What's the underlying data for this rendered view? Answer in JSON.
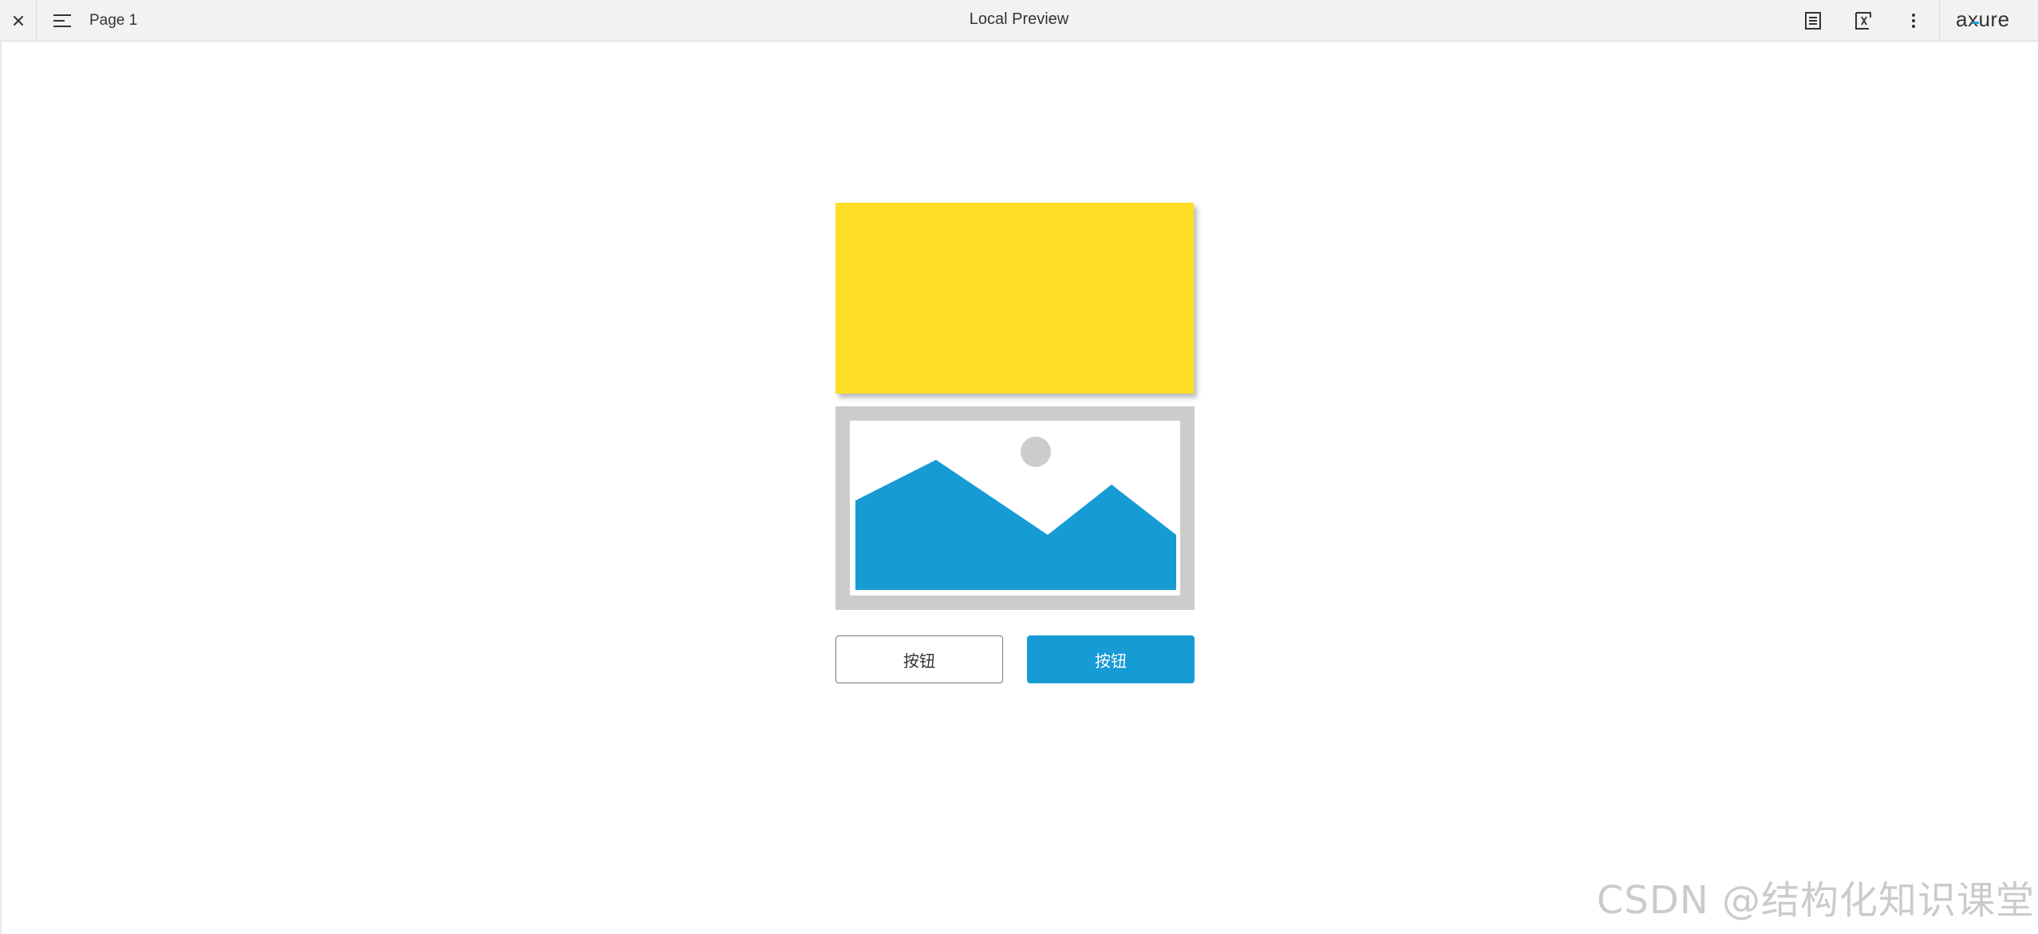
{
  "toolbar": {
    "close_icon": "close-icon",
    "menu_icon": "hamburger-menu-icon",
    "page_name": "Page 1",
    "title": "Local Preview",
    "notes_icon": "notes-icon",
    "variables_icon": "variables-icon",
    "more_icon": "more-vertical-icon",
    "logo_text": "axure"
  },
  "canvas": {
    "yellow_box_color": "#ffdf25",
    "image_placeholder_icon": "image-placeholder-icon",
    "mountain_color": "#169bd5",
    "buttons": {
      "secondary_label": "按钮",
      "primary_label": "按钮",
      "primary_color": "#169bd5"
    }
  },
  "watermark": "CSDN @结构化知识课堂"
}
